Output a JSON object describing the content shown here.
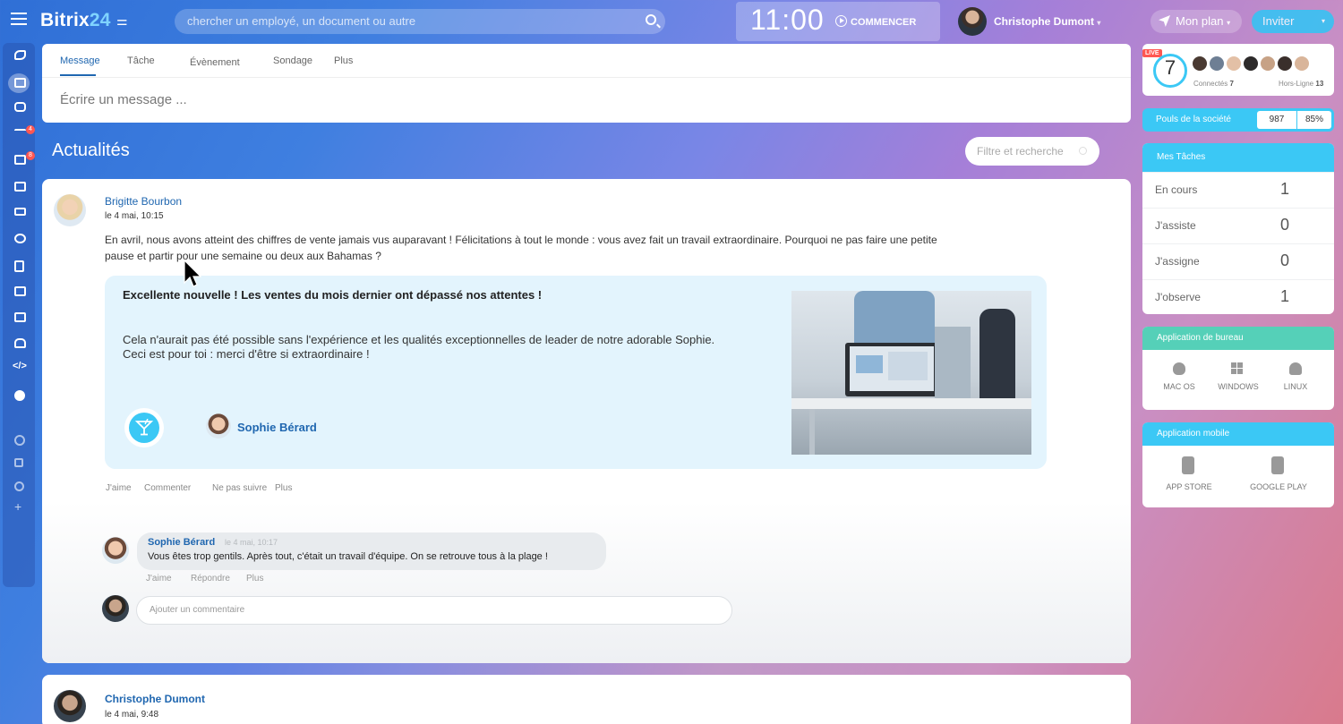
{
  "header": {
    "logo_main": "Bitrix",
    "logo_num": "24",
    "search_placeholder": "chercher un employé, un document ou autre",
    "clock": "11:00",
    "start_label": "COMMENCER",
    "user_name": "Christophe Dumont",
    "plan_label": "Mon plan",
    "invite_label": "Inviter"
  },
  "sidebar": {
    "badges": [
      "4",
      "8"
    ]
  },
  "composer": {
    "tabs": [
      "Message",
      "Tâche",
      "Évènement",
      "Sondage",
      "Plus"
    ],
    "placeholder": "Écrire un message ..."
  },
  "feed": {
    "title": "Actualités",
    "filter_placeholder": "Filtre et recherche"
  },
  "post": {
    "author": "Brigitte Bourbon",
    "date": "le 4 mai, 10:15",
    "text": "En avril, nous avons atteint des chiffres de vente jamais vus auparavant ! Félicitations à tout le monde : vous avez fait un travail extraordinaire. Pourquoi ne pas faire une petite pause et partir pour une semaine ou deux aux Bahamas ?",
    "card_title": "Excellente nouvelle ! Les ventes du mois dernier ont dépassé nos attentes !",
    "card_text_1": "Cela n'aurait pas été possible sans l'expérience et les qualités exceptionnelles de leader de notre adorable Sophie.",
    "card_text_2": "Ceci est pour toi : merci d'être si extraordinaire !",
    "hero_name": "Sophie Bérard",
    "actions": [
      "J'aime",
      "Commenter",
      "Ne pas suivre",
      "Plus"
    ]
  },
  "comment": {
    "author": "Sophie Bérard",
    "date": "le 4 mai, 10:17",
    "text": "Vous êtes trop gentils. Après tout, c'était un travail d'équipe. On se retrouve tous à la plage !",
    "actions": [
      "J'aime",
      "Répondre",
      "Plus"
    ],
    "add_placeholder": "Ajouter un commentaire"
  },
  "post2": {
    "author": "Christophe Dumont",
    "date": "le 4 mai, 9:48"
  },
  "widgets": {
    "live": {
      "badge": "LIVE",
      "count": "7",
      "online_label": "Connectés",
      "online_count": "7",
      "offline_label": "Hors-Ligne",
      "offline_count": "13"
    },
    "pulse": {
      "label": "Pouls de la société",
      "value": "987",
      "percent": "85%"
    },
    "tasks": {
      "title": "Mes Tâches",
      "rows": [
        {
          "label": "En cours",
          "value": "1"
        },
        {
          "label": "J'assiste",
          "value": "0"
        },
        {
          "label": "J'assigne",
          "value": "0"
        },
        {
          "label": "J'observe",
          "value": "1"
        }
      ]
    },
    "desktop": {
      "title": "Application de bureau",
      "apps": [
        "MAC OS",
        "WINDOWS",
        "LINUX"
      ]
    },
    "mobile": {
      "title": "Application mobile",
      "apps": [
        "APP STORE",
        "GOOGLE PLAY"
      ]
    }
  },
  "colors": {
    "accent": "#2fc6f6",
    "link": "#2067b0",
    "card_bg": "#e3f4fd",
    "badge": "#ff5752"
  }
}
